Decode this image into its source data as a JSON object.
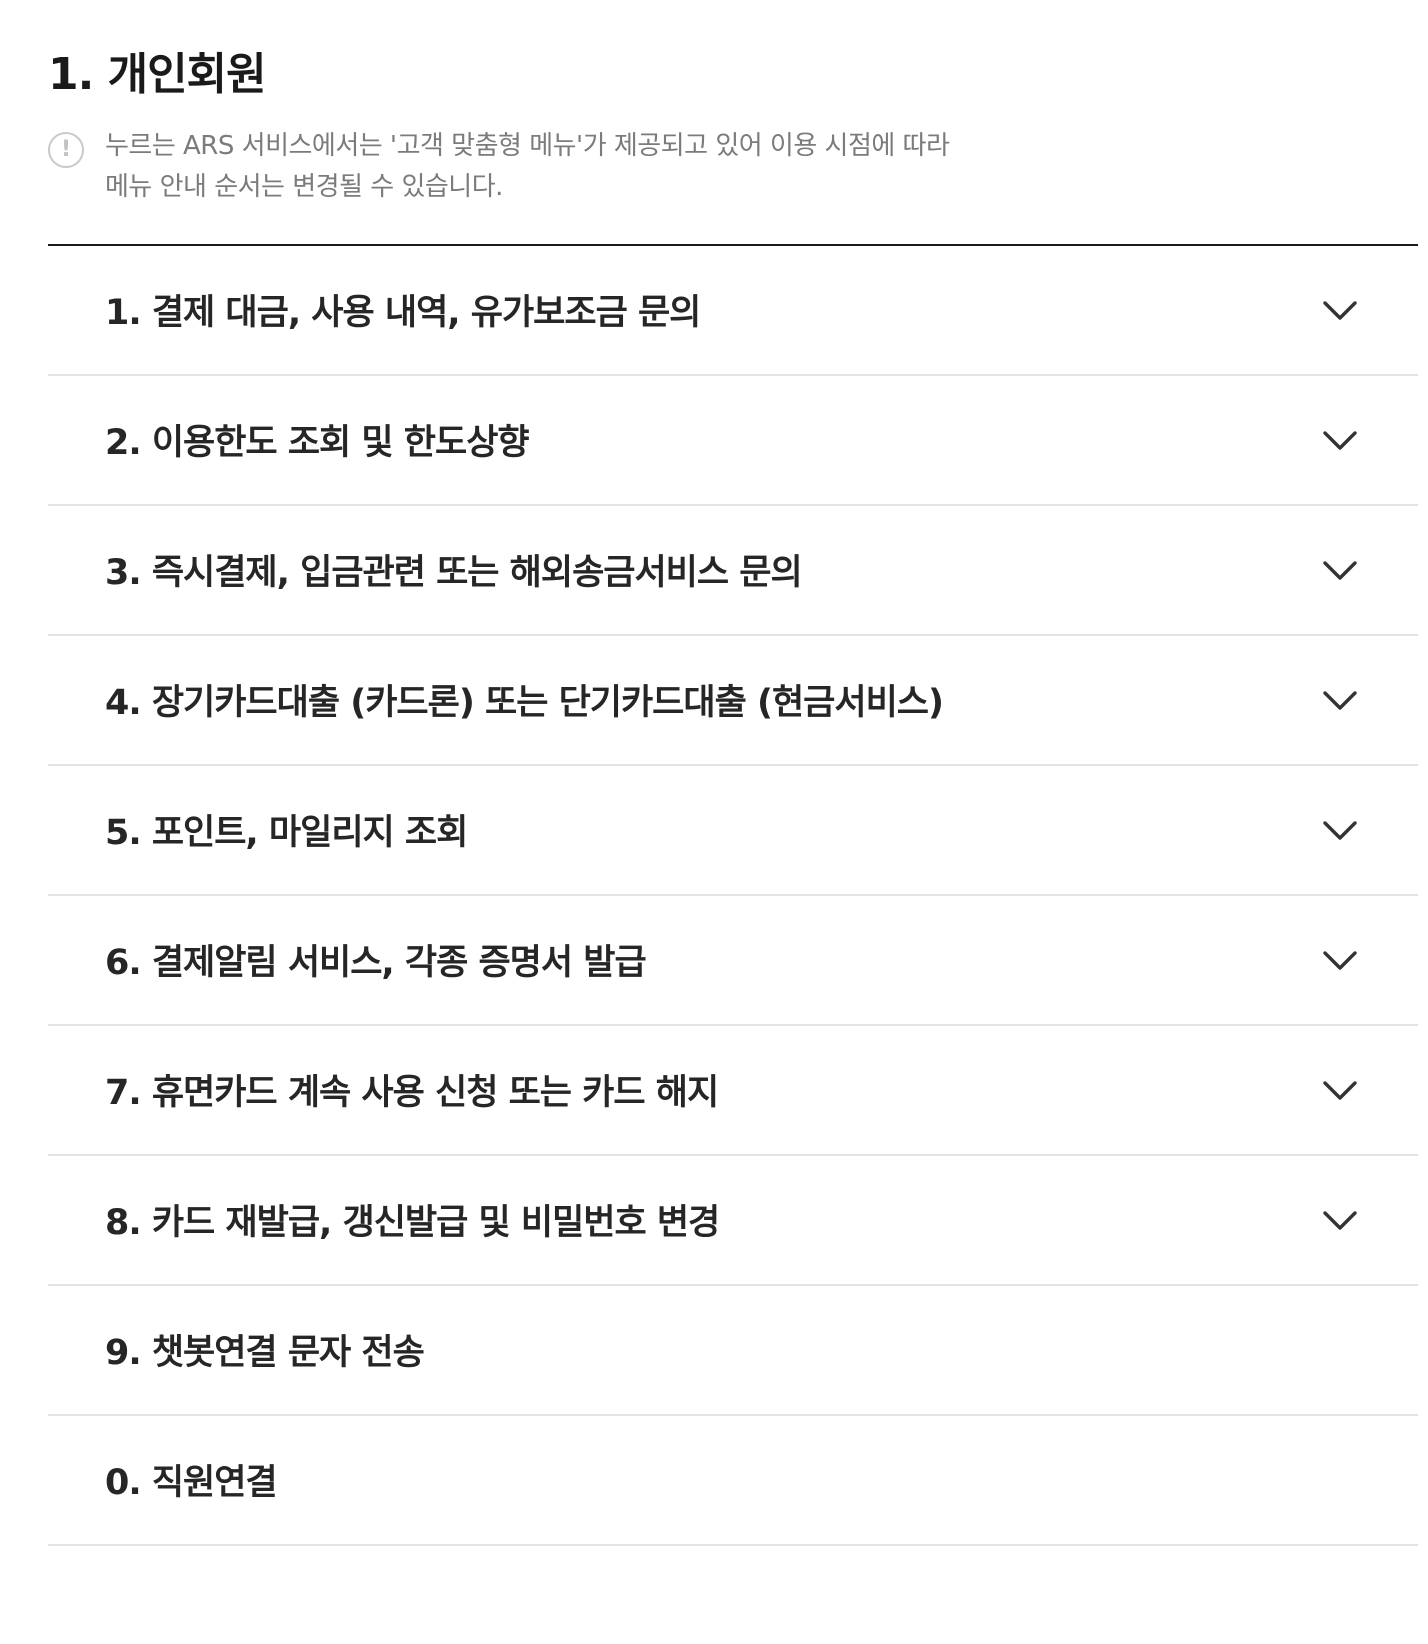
{
  "section": {
    "title": "1. 개인회원"
  },
  "notice": {
    "icon": "exclamation-circle-icon",
    "icon_glyph": "!",
    "line1": "누르는 ARS 서비스에서는 '고객 맞춤형 메뉴'가 제공되고 있어 이용 시점에 따라",
    "line2": "메뉴 안내 순서는 변경될 수 있습니다."
  },
  "menu": {
    "items": [
      {
        "label": "1. 결제 대금, 사용 내역, 유가보조금 문의",
        "expandable": true
      },
      {
        "label": "2. 이용한도 조회 및 한도상향",
        "expandable": true
      },
      {
        "label": "3. 즉시결제, 입금관련 또는 해외송금서비스 문의",
        "expandable": true
      },
      {
        "label": "4. 장기카드대출 (카드론) 또는 단기카드대출 (현금서비스)",
        "expandable": true
      },
      {
        "label": "5. 포인트, 마일리지 조회",
        "expandable": true
      },
      {
        "label": "6. 결제알림 서비스, 각종 증명서 발급",
        "expandable": true
      },
      {
        "label": "7. 휴면카드 계속 사용 신청 또는 카드 해지",
        "expandable": true
      },
      {
        "label": "8. 카드 재발급, 갱신발급 및 비밀번호 변경",
        "expandable": true
      },
      {
        "label": "9. 챗봇연결 문자 전송",
        "expandable": false
      },
      {
        "label": "0. 직원연결",
        "expandable": false
      }
    ]
  },
  "colors": {
    "title": "#1a1a1a",
    "text": "#262626",
    "notice_text": "#7b7b7b",
    "divider": "#e3e3e3",
    "top_rule": "#1a1a1a",
    "chevron": "#333333"
  }
}
